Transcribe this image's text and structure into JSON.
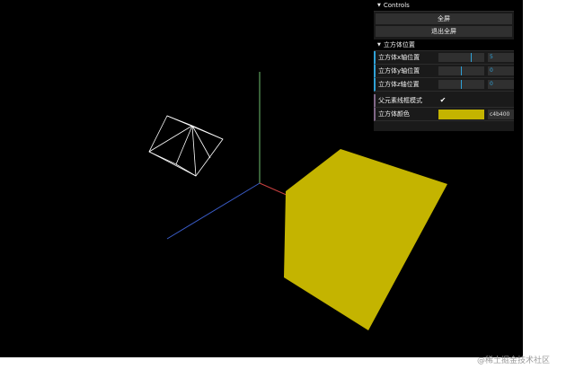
{
  "gui": {
    "title": "Controls",
    "buttons": [
      "全屏",
      "退出全屏"
    ],
    "folder": {
      "title": "立方体位置",
      "rows": [
        {
          "label": "立方体x轴位置",
          "value": "5",
          "fill": 0.7
        },
        {
          "label": "立方体y轴位置",
          "value": "0",
          "fill": 0.5
        },
        {
          "label": "立方体z轴位置",
          "value": "0",
          "fill": 0.5
        }
      ]
    },
    "wireframe": {
      "label": "父元素线框模式",
      "check": "✔"
    },
    "color": {
      "label": "立方体颜色",
      "hex": "c4b400",
      "value": "#c4b400"
    }
  },
  "watermark": "@稀土掘金技术社区",
  "colors": {
    "background": "#000000",
    "cube_top": "#c4b400",
    "axis_x": "#c04040",
    "axis_y": "#70c070",
    "axis_z": "#3050c0"
  }
}
